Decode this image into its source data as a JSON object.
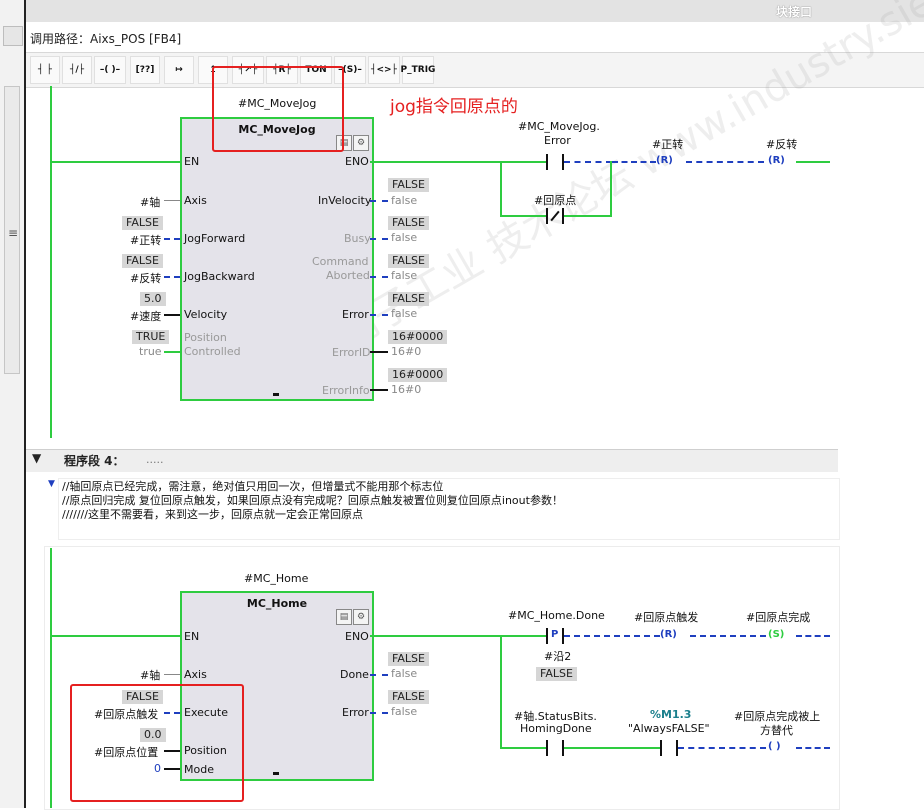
{
  "header": {
    "block_label": "块接口",
    "call_path": "调用路径：Aixs_POS [FB4]"
  },
  "toolbar": [
    "┤ ├",
    "┤/├",
    "–( )–",
    "[??]",
    "↦",
    "↥",
    "┤↗├",
    "┤R├",
    "TON",
    "–(S)–",
    "┤<>├",
    "P_TRIG"
  ],
  "annotation": "jog指令回原点的",
  "watermark": "西门子工业 技术论坛 www.industry.siemens.com/cs",
  "rung3": {
    "instance": "#MC_MoveJog",
    "block_name": "MC_MoveJog",
    "in_pins": {
      "en": "EN",
      "axis": "Axis",
      "jog_forward": "JogForward",
      "jog_backward": "JogBackward",
      "velocity": "Velocity",
      "pos_ctrl_1": "Position",
      "pos_ctrl_2": "Controlled"
    },
    "in_vars": {
      "axis": "#轴",
      "jog_forward": "#正转",
      "jog_backward": "#反转",
      "velocity": "#速度",
      "pos_ctrl": "true"
    },
    "in_vals": {
      "jog_forward": "FALSE",
      "jog_backward": "FALSE",
      "velocity": "5.0",
      "pos_ctrl": "TRUE"
    },
    "out_pins": {
      "eno": "ENO",
      "in_velocity": "InVelocity",
      "busy": "Busy",
      "cmd_aborted_1": "Command",
      "cmd_aborted_2": "Aborted",
      "error": "Error",
      "error_id": "ErrorID",
      "error_info": "ErrorInfo"
    },
    "out_vals": {
      "in_velocity": "FALSE",
      "busy": "FALSE",
      "cmd_aborted": "FALSE",
      "error": "FALSE",
      "error_id": "16#0000",
      "error_info": "16#0000"
    },
    "out_vars": {
      "in_velocity": "false",
      "busy": "false",
      "cmd_aborted": "false",
      "error": "false",
      "error_id": "16#0",
      "error_info": "16#0"
    },
    "contact_error_1": "#MC_MoveJog.",
    "contact_error_2": "Error",
    "contact_home": "#回原点",
    "coil_fwd": "#正转",
    "coil_rev": "#反转",
    "coil_char": "R"
  },
  "segment4": {
    "toggle": "▼",
    "title": "程序段 4：",
    "dots": ".....",
    "comment": [
      "//轴回原点已经完成，需注意，绝对值只用回一次，但增量式不能用那个标志位",
      "//原点回归完成 复位回原点触发，如果回原点没有完成呢？回原点触发被置位则复位回原点inout参数！",
      "///////这里不需要看，来到这一步，回原点就一定会正常回原点"
    ]
  },
  "rung4": {
    "instance": "#MC_Home",
    "block_name": "MC_Home",
    "in_pins": {
      "en": "EN",
      "axis": "Axis",
      "execute": "Execute",
      "position": "Position",
      "mode": "Mode"
    },
    "in_vars": {
      "axis": "#轴",
      "execute": "#回原点触发",
      "position": "#回原点位置",
      "mode": "0"
    },
    "in_vals": {
      "execute": "FALSE",
      "position": "0.0"
    },
    "out_pins": {
      "eno": "ENO",
      "done": "Done",
      "error": "Error"
    },
    "out_vals": {
      "done": "FALSE",
      "error": "FALSE"
    },
    "out_vars": {
      "done": "false",
      "error": "false"
    },
    "contact_done": "#MC_Home.Done",
    "p_char": "P",
    "edge_mem": "#沿2",
    "edge_val": "FALSE",
    "coil_reset": "#回原点触发",
    "coil_reset_char": "R",
    "coil_set": "#回原点完成",
    "coil_set_char": "S",
    "status_1": "#轴.StatusBits.",
    "status_2": "HomingDone",
    "m13": "%M1.3",
    "always_false": "\"AlwaysFALSE\"",
    "replaced_1": "#回原点完成被上",
    "replaced_2": "方替代"
  }
}
